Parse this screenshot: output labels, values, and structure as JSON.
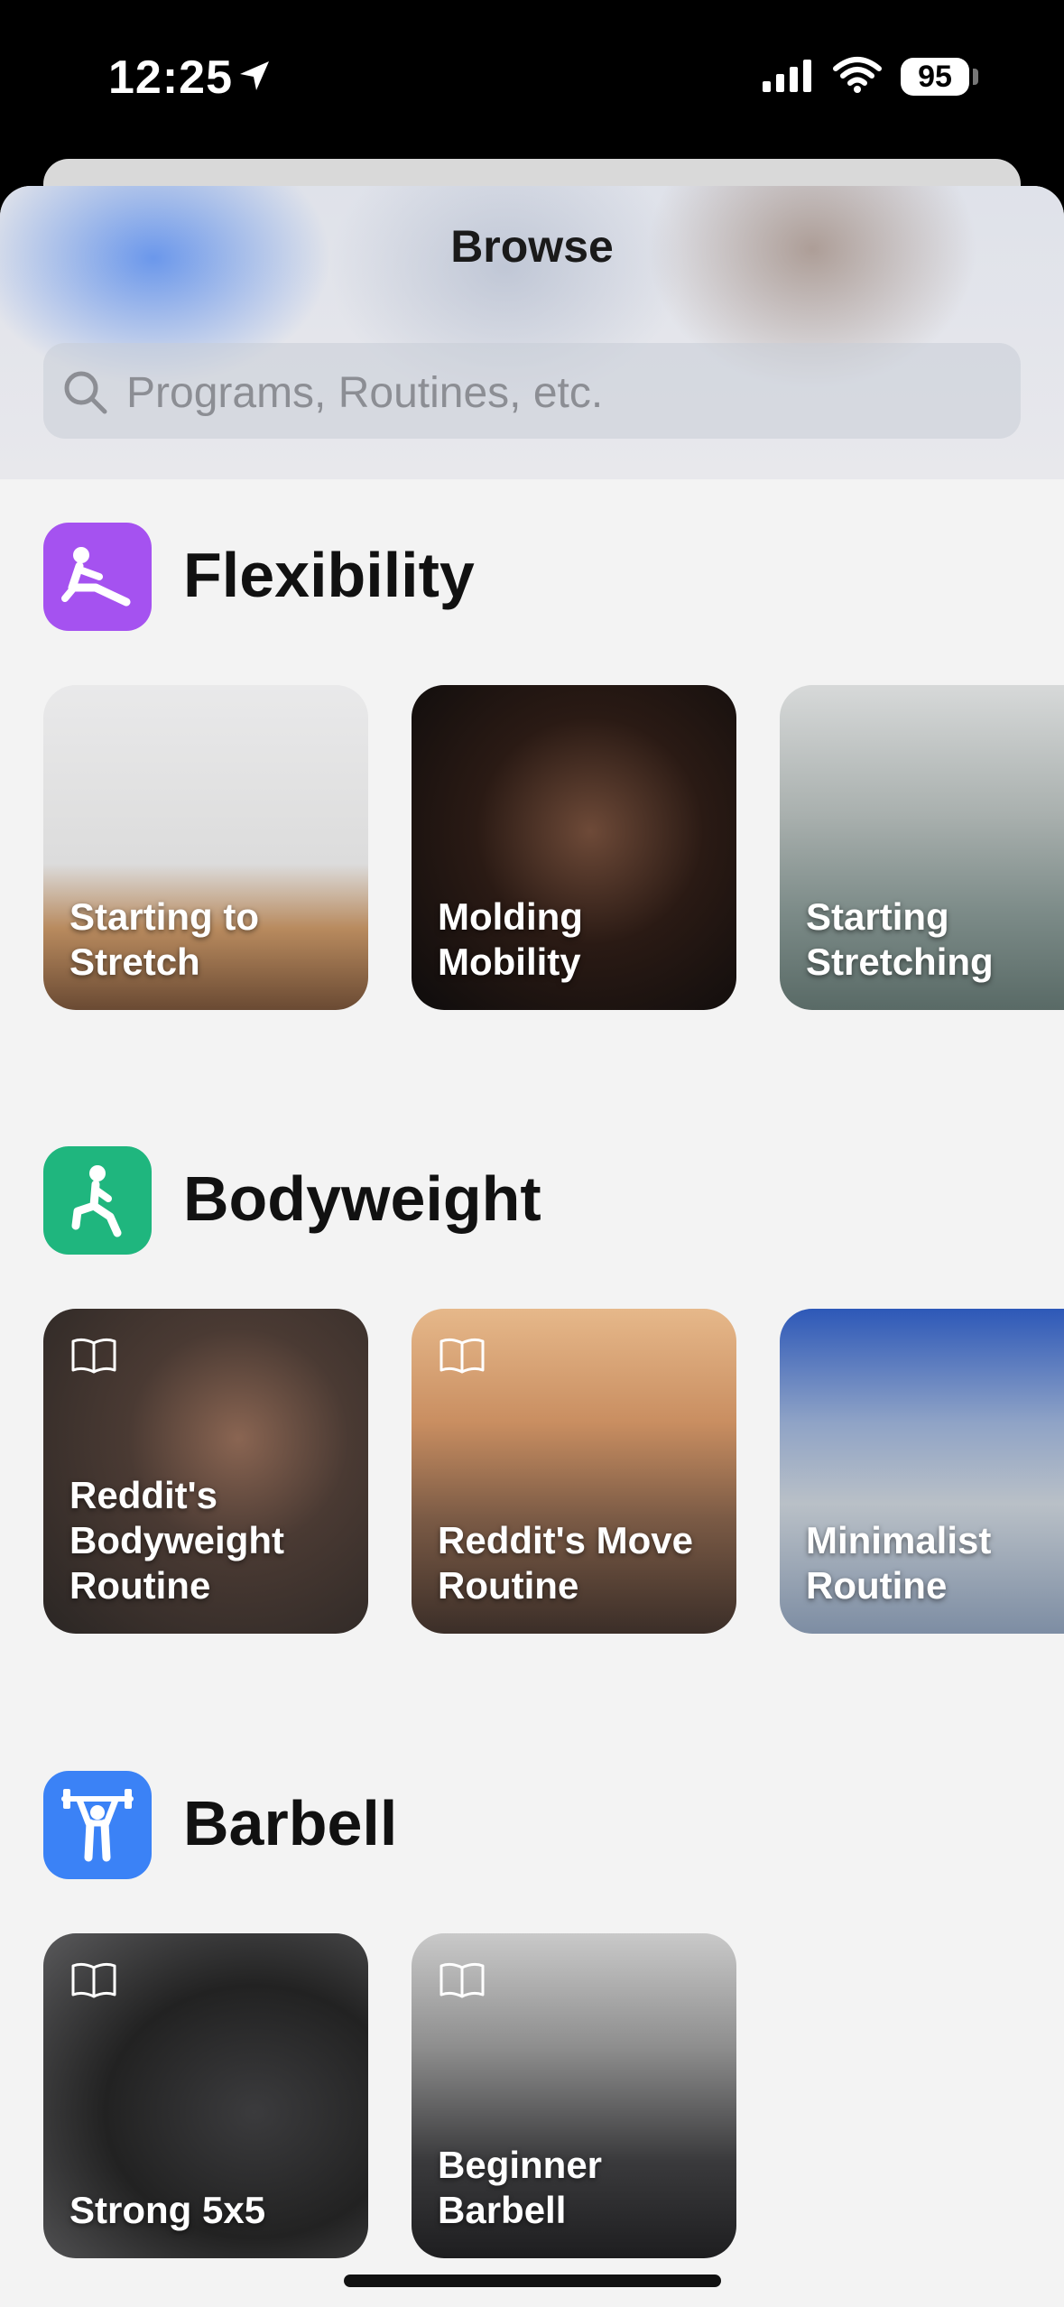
{
  "status": {
    "time": "12:25",
    "battery": "95"
  },
  "header": {
    "title": "Browse",
    "search_placeholder": "Programs, Routines, etc."
  },
  "sections": [
    {
      "title": "Flexibility",
      "color": "#a552f0",
      "cards": [
        {
          "label": "Starting to Stretch"
        },
        {
          "label": "Molding Mobility"
        },
        {
          "label": "Starting Stretching"
        }
      ]
    },
    {
      "title": "Bodyweight",
      "color": "#1fb67e",
      "cards": [
        {
          "label": "Reddit's Bodyweight Routine"
        },
        {
          "label": "Reddit's Move Routine"
        },
        {
          "label": "Minimalist Routine"
        }
      ]
    },
    {
      "title": "Barbell",
      "color": "#3b82f6",
      "cards": [
        {
          "label": "Strong 5x5"
        },
        {
          "label": "Beginner Barbell"
        }
      ]
    }
  ]
}
